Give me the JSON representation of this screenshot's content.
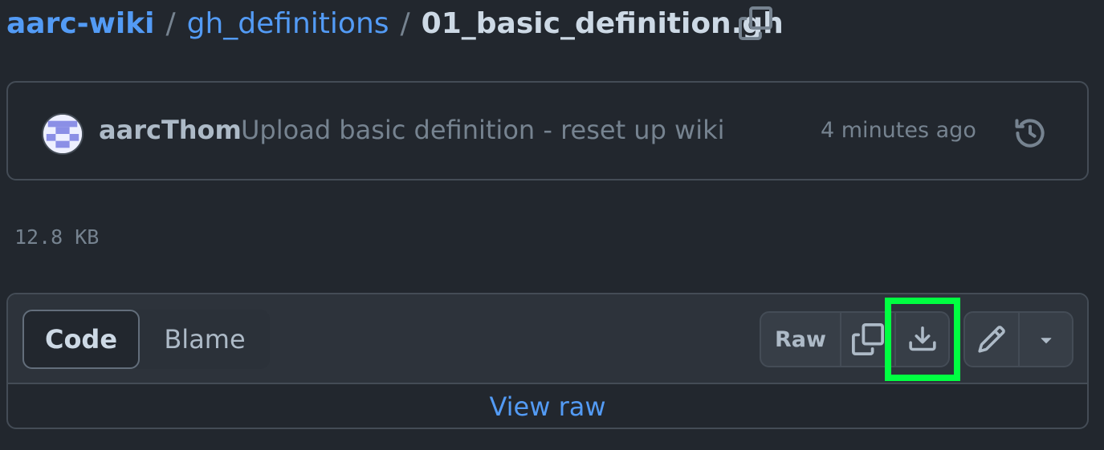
{
  "breadcrumb": {
    "repo": "aarc-wiki",
    "separator": "/",
    "folder": "gh_definitions",
    "file": "01_basic_definition.gh"
  },
  "commit": {
    "author": "aarcThom",
    "message": "Upload basic definition - reset up wiki",
    "time": "4 minutes ago"
  },
  "file_info": {
    "size": "12.8 KB"
  },
  "file_view": {
    "tabs": [
      {
        "label": "Code",
        "selected": true
      },
      {
        "label": "Blame",
        "selected": false
      }
    ],
    "raw_label": "Raw",
    "view_raw_label": "View raw"
  },
  "icons": {
    "copy_path": "copy-icon",
    "history": "history-icon",
    "copy_raw": "copy-icon",
    "download": "download-icon",
    "edit": "pencil-icon",
    "more": "triangle-down-icon"
  },
  "colors": {
    "background": "#22272e",
    "link": "#539bf5",
    "highlight": "#00ff41"
  }
}
